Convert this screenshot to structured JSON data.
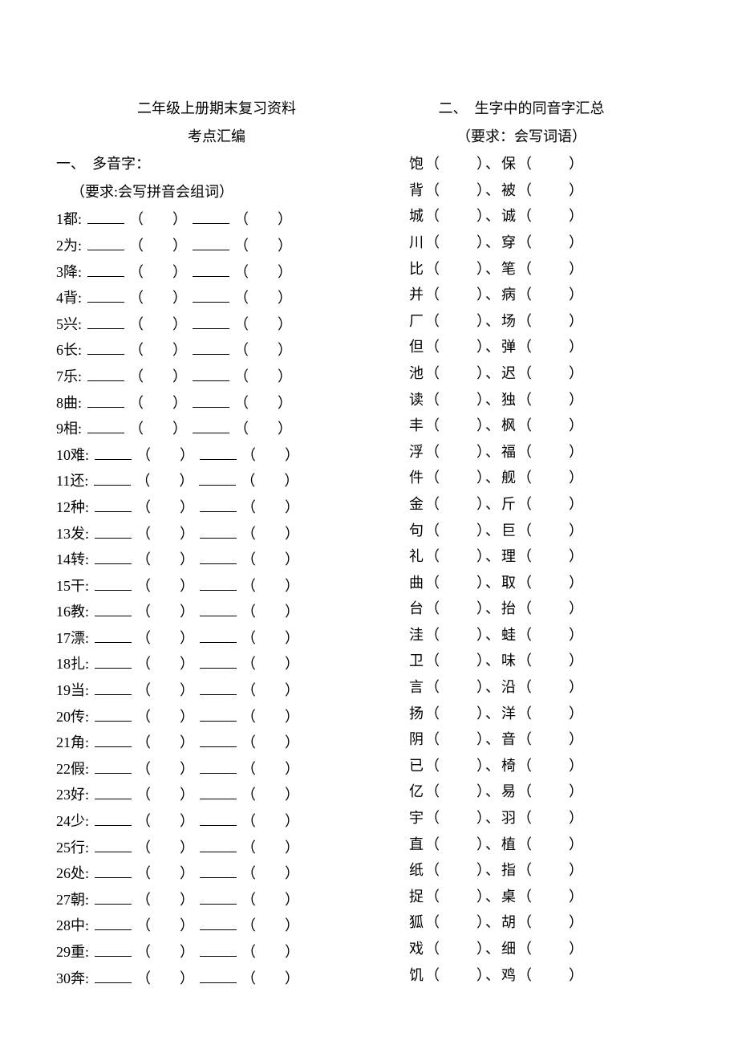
{
  "left": {
    "title": "二年级上册期末复习资料",
    "subtitle": "考点汇编",
    "section1_head": "一、　多音字：",
    "section1_note": "（要求:会写拼音会组词）",
    "items": [
      {
        "num": "1",
        "char": "都"
      },
      {
        "num": "2",
        "char": "为"
      },
      {
        "num": "3",
        "char": "降"
      },
      {
        "num": "4",
        "char": "背"
      },
      {
        "num": "5",
        "char": "兴"
      },
      {
        "num": "6",
        "char": "长"
      },
      {
        "num": "7",
        "char": "乐"
      },
      {
        "num": "8",
        "char": "曲"
      },
      {
        "num": "9",
        "char": "相"
      },
      {
        "num": "10",
        "char": "难"
      },
      {
        "num": "11",
        "char": "还"
      },
      {
        "num": "12",
        "char": "种"
      },
      {
        "num": "13",
        "char": "发"
      },
      {
        "num": "14",
        "char": "转"
      },
      {
        "num": "15",
        "char": "干"
      },
      {
        "num": "16",
        "char": "教"
      },
      {
        "num": "17",
        "char": "漂"
      },
      {
        "num": "18",
        "char": "扎"
      },
      {
        "num": "19",
        "char": "当"
      },
      {
        "num": "20",
        "char": "传"
      },
      {
        "num": "21",
        "char": "角"
      },
      {
        "num": "22",
        "char": "假"
      },
      {
        "num": "23",
        "char": "好"
      },
      {
        "num": "24",
        "char": "少"
      },
      {
        "num": "25",
        "char": "行"
      },
      {
        "num": "26",
        "char": "处"
      },
      {
        "num": "27",
        "char": "朝"
      },
      {
        "num": "28",
        "char": "中"
      },
      {
        "num": "29",
        "char": "重"
      },
      {
        "num": "30",
        "char": "奔"
      }
    ]
  },
  "right": {
    "section2_head": "二、　生字中的同音字汇总",
    "section2_note": "（要求：会写词语）",
    "pairs": [
      {
        "a": "饱",
        "b": "保"
      },
      {
        "a": "背",
        "b": "被"
      },
      {
        "a": "城",
        "b": "诚"
      },
      {
        "a": "川",
        "b": "穿"
      },
      {
        "a": "比",
        "b": "笔"
      },
      {
        "a": "并",
        "b": "病"
      },
      {
        "a": "厂",
        "b": "场"
      },
      {
        "a": "但",
        "b": "弹"
      },
      {
        "a": "池",
        "b": "迟"
      },
      {
        "a": "读",
        "b": "独"
      },
      {
        "a": "丰",
        "b": "枫"
      },
      {
        "a": "浮",
        "b": "福"
      },
      {
        "a": "件",
        "b": "舰"
      },
      {
        "a": "金",
        "b": "斤"
      },
      {
        "a": "句",
        "b": "巨"
      },
      {
        "a": "礼",
        "b": "理"
      },
      {
        "a": "曲",
        "b": "取"
      },
      {
        "a": "台",
        "b": "抬"
      },
      {
        "a": "洼",
        "b": "蛙"
      },
      {
        "a": "卫",
        "b": "味"
      },
      {
        "a": "言",
        "b": "沿"
      },
      {
        "a": "扬",
        "b": "洋"
      },
      {
        "a": "阴",
        "b": "音"
      },
      {
        "a": "已",
        "b": "椅"
      },
      {
        "a": "亿",
        "b": "易"
      },
      {
        "a": "宇",
        "b": "羽"
      },
      {
        "a": "直",
        "b": "植"
      },
      {
        "a": "纸",
        "b": "指"
      },
      {
        "a": "捉",
        "b": "桌"
      },
      {
        "a": "狐",
        "b": "胡"
      },
      {
        "a": "戏",
        "b": "细"
      },
      {
        "a": "饥",
        "b": "鸡"
      }
    ]
  },
  "glyphs": {
    "lp": "（",
    "rp": "）",
    "colon": ":",
    "dot": "、"
  }
}
